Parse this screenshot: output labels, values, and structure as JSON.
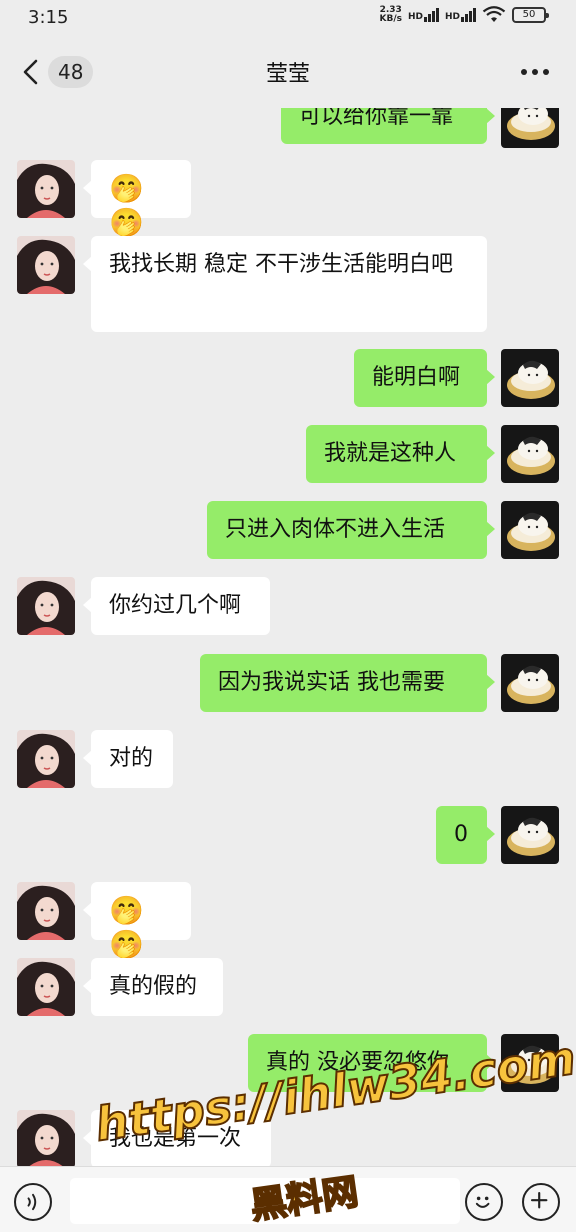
{
  "status_bar": {
    "time": "3:15",
    "net_speed_value": "2.33",
    "net_speed_unit": "KB/s",
    "sim1": "HD",
    "sim2": "HD",
    "battery": "50"
  },
  "header": {
    "unread_count": "48",
    "title": "莹莹"
  },
  "messages": [
    {
      "side": "right",
      "text": "可以给你靠一靠"
    },
    {
      "side": "left",
      "text": "🤭🤭",
      "emoji": true
    },
    {
      "side": "left",
      "text": "我找长期 稳定 不干涉生活能明白吧"
    },
    {
      "side": "right",
      "text": "能明白啊"
    },
    {
      "side": "right",
      "text": "我就是这种人"
    },
    {
      "side": "right",
      "text": "只进入肉体不进入生活"
    },
    {
      "side": "left",
      "text": "你约过几个啊"
    },
    {
      "side": "right",
      "text": "因为我说实话 我也需要"
    },
    {
      "side": "left",
      "text": "对的"
    },
    {
      "side": "right",
      "text": "0"
    },
    {
      "side": "left",
      "text": "🤭🤭",
      "emoji": true
    },
    {
      "side": "left",
      "text": "真的假的"
    },
    {
      "side": "right",
      "text": "真的 没必要忽悠你"
    },
    {
      "side": "left",
      "text": "我也是第一次"
    }
  ],
  "watermark": {
    "url": "https://ihlw34.com",
    "name": "黑料网"
  },
  "colors": {
    "background": "#ededed",
    "sent_bubble": "#95ec69",
    "received_bubble": "#ffffff"
  }
}
